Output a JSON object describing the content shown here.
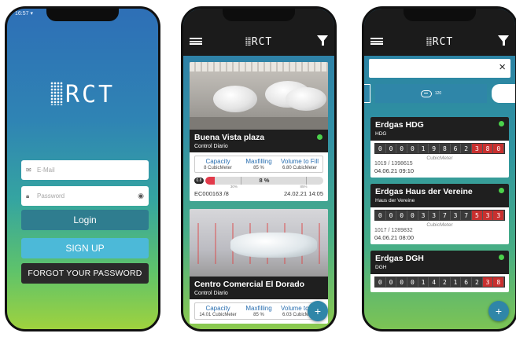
{
  "login": {
    "status_time": "16:57 ▾",
    "logo": "RCT",
    "email_placeholder": "E-Mail",
    "password_placeholder": "Password",
    "login_label": "Login",
    "signup_label": "SIGN UP",
    "forgot_label": "FORGOT YOUR PASSWORD"
  },
  "header": {
    "logo": "RCT"
  },
  "tanks": [
    {
      "name": "Buena Vista plaza",
      "subtitle": "Control Diario",
      "metrics": [
        {
          "label": "Capacity",
          "value": "8 CubicMeter"
        },
        {
          "label": "Maxfilling",
          "value": "85 %"
        },
        {
          "label": "Volume to Fill",
          "value": "6.80 CubicMeter"
        }
      ],
      "fill_badge": "0.8",
      "fill_percent": 8,
      "fill_label": "8 %",
      "tick_labels": [
        "30%",
        "85%"
      ],
      "code": "EC000163 /8",
      "timestamp": "24.02.21 14:05"
    },
    {
      "name": "Centro Comercial El Dorado",
      "subtitle": "Control Diario",
      "metrics": [
        {
          "label": "Capacity",
          "value": "14.01 CubicMeter"
        },
        {
          "label": "Maxfilling",
          "value": "85 %"
        },
        {
          "label": "Volume to Fill",
          "value": "6.03 CubicMeter"
        }
      ]
    }
  ],
  "search": {
    "clear_icon": "×"
  },
  "segment": {
    "label": "120"
  },
  "meters": [
    {
      "name": "Erdgas HDG",
      "subtitle": "HDG",
      "digits": [
        "0",
        "0",
        "0",
        "0",
        "1",
        "9",
        "8",
        "6",
        "2",
        "3",
        "8",
        "0"
      ],
      "red_from": 9,
      "unit": "CubicMeter",
      "ids": "1019     / 1398615",
      "date": "04.06.21 09:10"
    },
    {
      "name": "Erdgas Haus der Vereine",
      "subtitle": "Haus der Vereine",
      "digits": [
        "0",
        "0",
        "0",
        "0",
        "3",
        "3",
        "7",
        "3",
        "7",
        "5",
        "3",
        "3"
      ],
      "red_from": 9,
      "unit": "CubicMeter",
      "ids": "1017     / 1289832",
      "date": "04.06.21 08:00"
    },
    {
      "name": "Erdgas DGH",
      "subtitle": "DGH",
      "digits": [
        "0",
        "0",
        "0",
        "0",
        "1",
        "4",
        "2",
        "1",
        "6",
        "2",
        "3",
        "8"
      ],
      "red_from": 10,
      "unit": "",
      "ids": "",
      "date": ""
    }
  ],
  "fab": "+",
  "colors": {
    "accent": "#2f86a8",
    "header": "#1b1b1b",
    "alarm_red": "#c8302f",
    "status_green": "#4bd14b",
    "link_blue": "#2a6fb0"
  }
}
